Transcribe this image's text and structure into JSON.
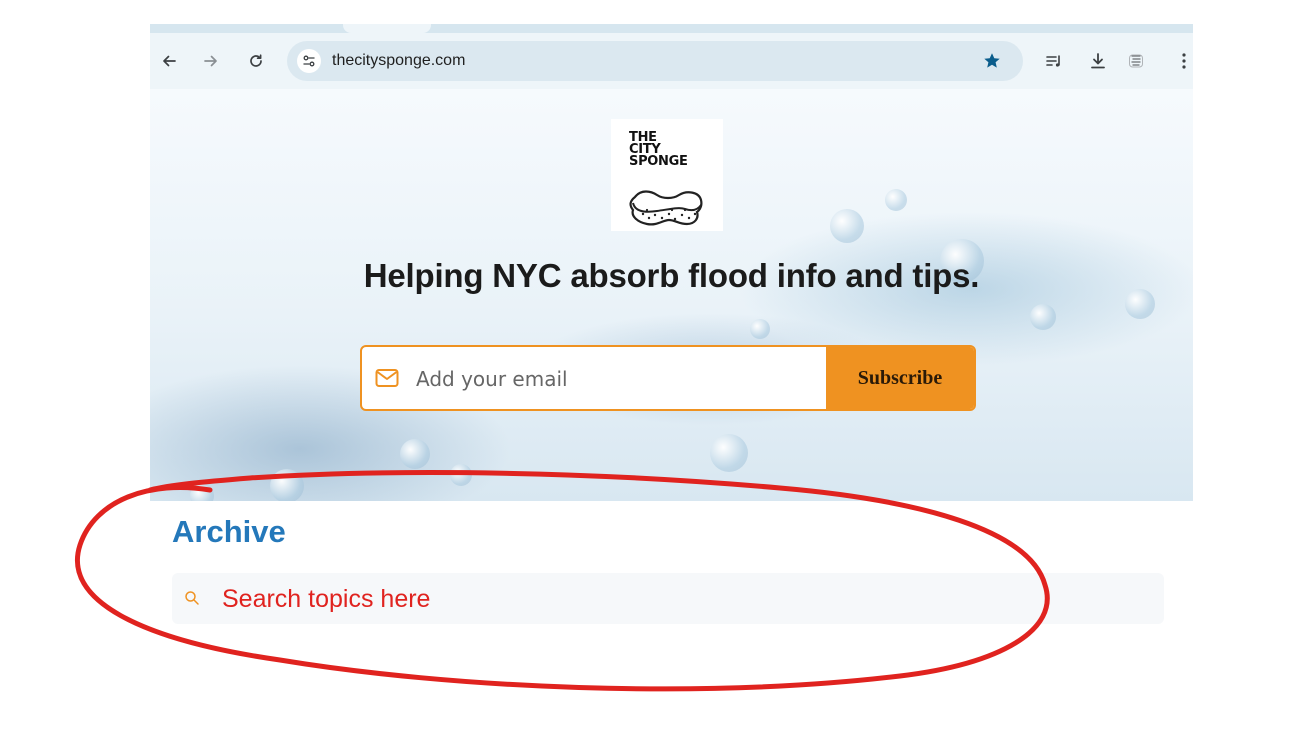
{
  "browser": {
    "back_icon": "arrow-left-icon",
    "forward_icon": "arrow-right-icon",
    "reload_icon": "reload-icon",
    "site_info_icon": "tune-icon",
    "url": "thecitysponge.com",
    "bookmark_icon": "star-icon",
    "toolbar_icons": [
      "reading-list-icon",
      "download-icon",
      "extension-icon",
      "more-vert-icon"
    ],
    "bookmark_color": "#0b5d8c"
  },
  "page": {
    "logo": {
      "lines": [
        "THE",
        "CITY",
        "SPONGE"
      ],
      "icon": "sponge-icon"
    },
    "headline": "Helping NYC absorb flood info and tips.",
    "signup": {
      "email_placeholder": "Add your email",
      "email_icon": "mail-icon",
      "subscribe_label": "Subscribe"
    },
    "archive": {
      "title": "Archive",
      "search_placeholder": "Search topics here",
      "search_icon": "search-icon"
    }
  },
  "colors": {
    "accent_orange": "#ef9221",
    "archive_blue": "#2478ba",
    "annotation_red": "#e0231f"
  }
}
